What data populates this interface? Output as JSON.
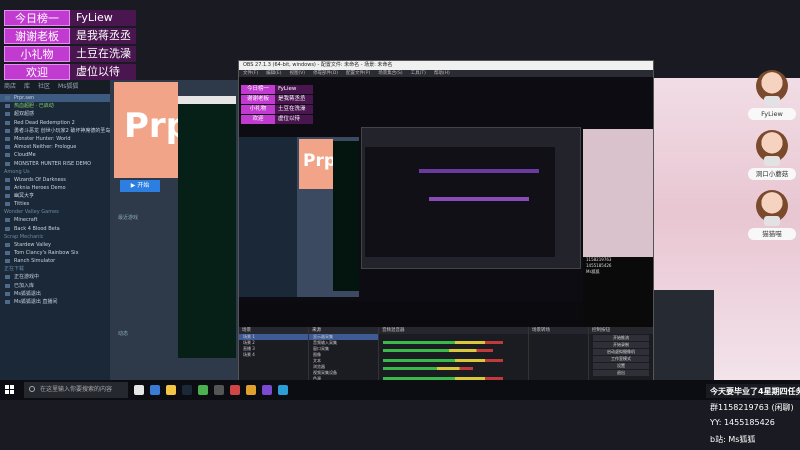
{
  "board": [
    {
      "key": "今日榜一",
      "value": "FyLiew"
    },
    {
      "key": "谢谢老板",
      "value": "是我蒋丞丞"
    },
    {
      "key": "小礼物",
      "value": "土豆在洗澡"
    },
    {
      "key": "欢迎",
      "value": "虚位以待"
    }
  ],
  "left_app": {
    "tabs": [
      "商店",
      "库",
      "社区",
      "Ms狐狐"
    ],
    "items": [
      {
        "label": "Prpr.sen",
        "style": "sel"
      },
      {
        "label": "热血超胆 · 已启动",
        "style": "green"
      },
      {
        "label": "超双超感"
      },
      {
        "label": "Red Dead Redemption 2"
      },
      {
        "label": "勇者斗恶龙 创世小玩家2 破坏神席德的圣岛"
      },
      {
        "label": "Monster Hunter: World"
      },
      {
        "label": "Almost Neither: Prologue"
      },
      {
        "label": "CloudMe"
      },
      {
        "label": "MONSTER HUNTER RISE DEMO"
      },
      {
        "label": "Among Us",
        "style": "section"
      },
      {
        "label": "Wizards Of Darkness"
      },
      {
        "label": "Arknia Heroes Demo"
      },
      {
        "label": "幽冥大亨"
      },
      {
        "label": "Titties"
      },
      {
        "label": "Wonder Valley Games",
        "style": "section"
      },
      {
        "label": "Minecraft"
      },
      {
        "label": "Back 4 Blood Beta"
      },
      {
        "label": "Scrap Mechanic",
        "style": "section"
      },
      {
        "label": "Stardew Valley"
      },
      {
        "label": "Tom Clancy's Rainbow Six"
      },
      {
        "label": "Ranch Simulator"
      },
      {
        "label": "正在下载",
        "style": "section"
      },
      {
        "label": "正在游戏中"
      },
      {
        "label": "已加入库"
      },
      {
        "label": "Ms狐狐退出"
      },
      {
        "label": "Ms狐狐退出 直播间"
      }
    ]
  },
  "middle": {
    "big_text": "Prp",
    "play_label": "▶ 开始",
    "text1": "最近游戏",
    "text2": "动态"
  },
  "obs": {
    "title": "OBS 27.1.3 (64-bit, windows) - 配置文件: 未命名 - 场景: 未命名",
    "menu": [
      "文件(F)",
      "编辑(E)",
      "视图(V)",
      "停靠部件(D)",
      "配置文件(P)",
      "场景集合(S)",
      "工具(T)",
      "帮助(H)"
    ],
    "scenes_header": "场景",
    "scenes": [
      "场景 1",
      "场景 2",
      "直播 3",
      "场景 4"
    ],
    "sources_header": "来源",
    "sources": [
      "显示器采集",
      "音频输入采集",
      "窗口采集",
      "图像",
      "文本",
      "浏览器",
      "视频采集设备",
      "色源"
    ],
    "mixer_header": "音频混音器",
    "transitions_header": "场景转场",
    "controls_header": "控制按钮",
    "controls": [
      "开始推流",
      "开始录制",
      "启动虚拟摄像机",
      "工作室模式",
      "设置",
      "退出"
    ],
    "nested_chat": [
      "1158219763",
      "1455185426",
      "Ms狐狐"
    ]
  },
  "right_panel": {
    "avatars": [
      {
        "name": "FyLiew"
      },
      {
        "name": "洞口小蘑菇"
      },
      {
        "name": "猫猫喵"
      }
    ]
  },
  "taskbar": {
    "search_placeholder": "在这里输入你要搜索的内容"
  },
  "info": {
    "line1": "今天要毕业了4星期四任务",
    "line2": "群1158219763 (闲聊)",
    "line3": "YY:  1455185426",
    "line4": "b站: Ms狐狐"
  },
  "colors": {
    "board_key": "#c23bd0",
    "board_value": "#4a1650",
    "obs_bg": "#1e1e24",
    "accent_blue": "#2c7fe0",
    "pink_bg": "#f1dde5"
  }
}
